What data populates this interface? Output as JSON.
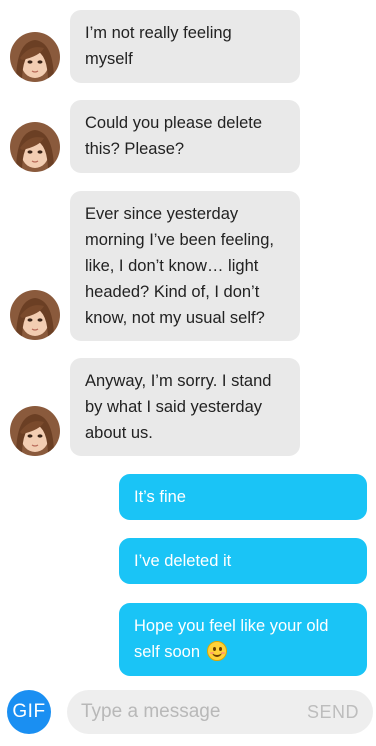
{
  "messages": [
    {
      "from": "them",
      "text": "I’m not really feeling\nmyself"
    },
    {
      "from": "them",
      "text": "Could you please delete\nthis? Please?"
    },
    {
      "from": "them",
      "text": "Ever since yesterday\nmorning I’ve been feeling,\nlike, I don’t know… light\nheaded? Kind of, I don’t\nknow, not my usual self?"
    },
    {
      "from": "them",
      "text": "Anyway, I’m sorry. I stand\nby what I said yesterday\nabout us."
    },
    {
      "from": "me",
      "text": "It’s fine"
    },
    {
      "from": "me",
      "text": "I’ve deleted it"
    },
    {
      "from": "me",
      "text": "Hope you feel like your old\nself soon",
      "emoji": "smiling-face-emoji"
    }
  ],
  "composer": {
    "gif_label": "GIF",
    "placeholder": "Type a message",
    "send_label": "SEND"
  },
  "colors": {
    "incoming_bubble": "#e9e9e9",
    "outgoing_bubble": "#1ac4f6",
    "gif_button": "#1a8ff2",
    "input_background": "#eeeeee"
  }
}
